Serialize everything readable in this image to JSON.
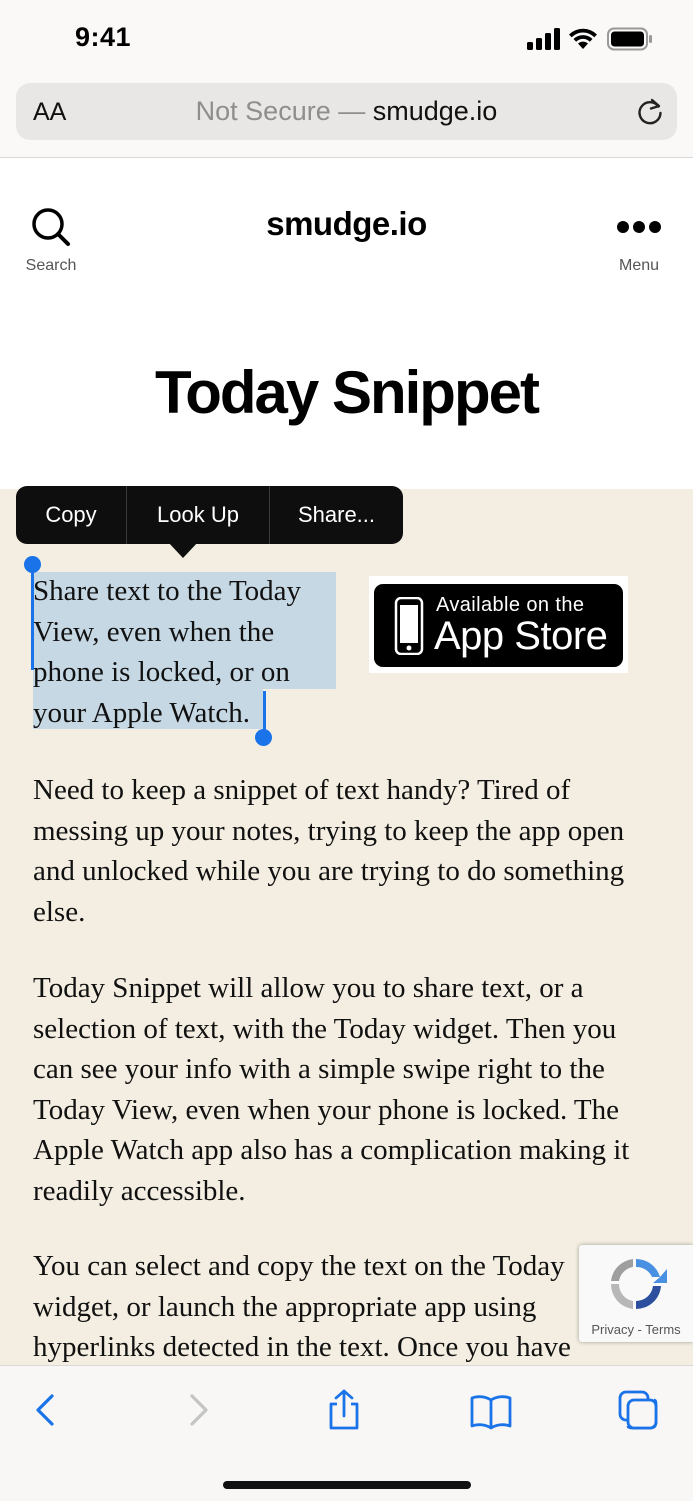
{
  "status_bar": {
    "time": "9:41"
  },
  "address_bar": {
    "text_size_label": "AA",
    "not_secure": "Not Secure —",
    "host": "smudge.io"
  },
  "site_header": {
    "search_label": "Search",
    "site_name": "smudge.io",
    "menu_label": "Menu"
  },
  "page": {
    "title": "Today Snippet",
    "selected_paragraph": "Share text to the Today View, even when the phone is locked, or on your Apple Watch.",
    "paragraph_2": "Need to keep a snippet of text handy? Tired of messing up your notes, trying to keep the app open and unlocked while you are trying to do something else.",
    "paragraph_3": "Today Snippet will allow you to share text, or a selection of text, with the Today widget. Then you can see your info with a simple swipe right to the Today View, even when your phone is locked. The Apple Watch app also has a complication making it readily accessible.",
    "paragraph_4": "You can select and copy the text on the Today widget, or launch the appropriate app using hyperlinks detected in the text. Once you have",
    "app_store_badge": {
      "line1": "Available on the",
      "line2": "App Store"
    }
  },
  "context_menu": {
    "items": [
      "Copy",
      "Look Up",
      "Share..."
    ]
  },
  "recaptcha": {
    "links": "Privacy - Terms"
  },
  "colors": {
    "selection": "#c6d8e4",
    "selection_handles": "#1a73e8",
    "toolbar_icons": "#1a73e8",
    "content_background": "#f3eee1"
  },
  "toolbar": {
    "icons": [
      "back-icon",
      "forward-icon",
      "share-icon",
      "bookmarks-icon",
      "tabs-icon"
    ]
  }
}
